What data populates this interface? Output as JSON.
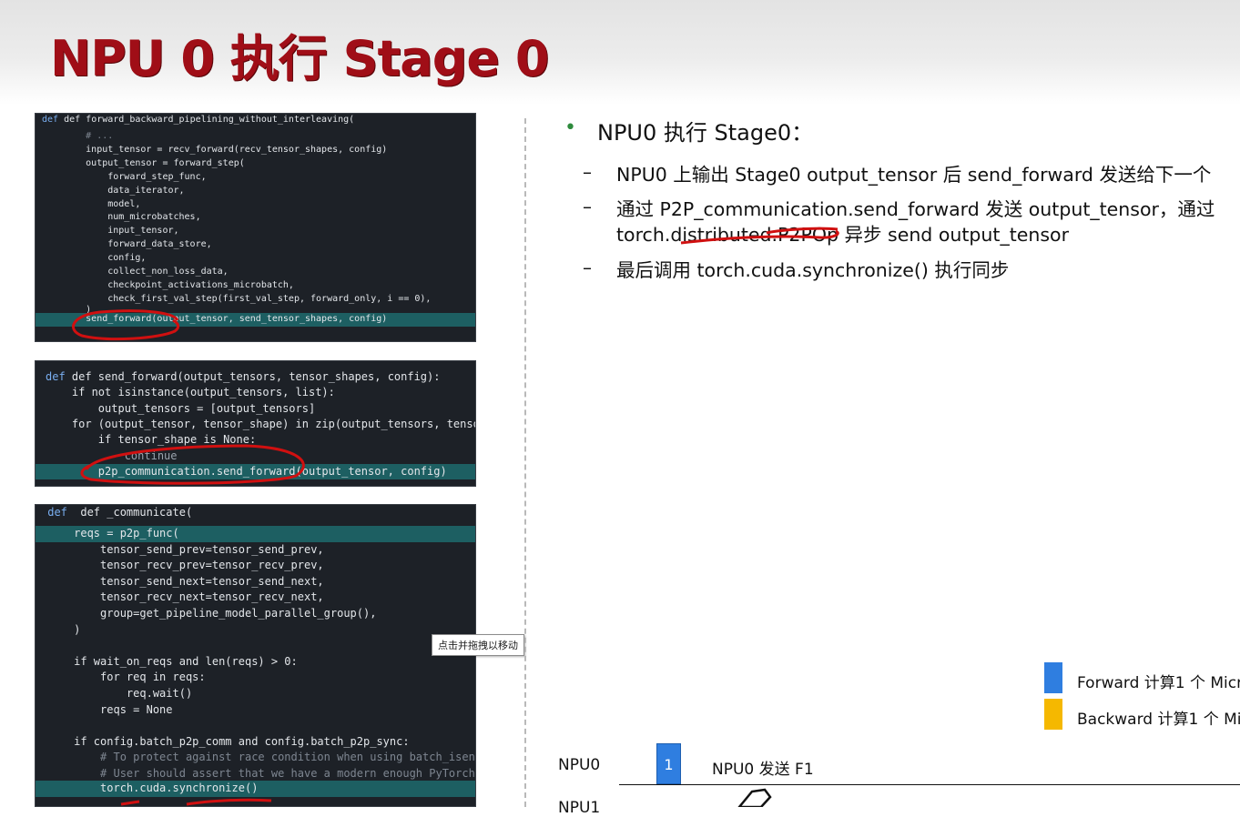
{
  "title": "NPU 0 执行 Stage 0",
  "code_blocks": [
    {
      "lines": [
        "def forward_backward_pipelining_without_interleaving(",
        "        # ...",
        "        input_tensor = recv_forward(recv_tensor_shapes, config)",
        "        output_tensor = forward_step(",
        "            forward_step_func,",
        "            data_iterator,",
        "            model,",
        "            num_microbatches,",
        "            input_tensor,",
        "            forward_data_store,",
        "            config,",
        "            collect_non_loss_data,",
        "            checkpoint_activations_microbatch,",
        "            check_first_val_step(first_val_step, forward_only, i == 0),",
        "        )",
        "        send_forward(output_tensor, send_tensor_shapes, config)"
      ]
    },
    {
      "lines": [
        "def send_forward(output_tensors, tensor_shapes, config):",
        "    if not isinstance(output_tensors, list):",
        "        output_tensors = [output_tensors]",
        "    for (output_tensor, tensor_shape) in zip(output_tensors, tensor_",
        "        if tensor_shape is None:",
        "            continue",
        "        p2p_communication.send_forward(output_tensor, config)"
      ]
    },
    {
      "lines": [
        " def _communicate(",
        "     reqs = p2p_func(",
        "         tensor_send_prev=tensor_send_prev,",
        "         tensor_recv_prev=tensor_recv_prev,",
        "         tensor_send_next=tensor_send_next,",
        "         tensor_recv_next=tensor_recv_next,",
        "         group=get_pipeline_model_parallel_group(),",
        "     )",
        "",
        "     if wait_on_reqs and len(reqs) > 0:",
        "         for req in reqs:",
        "             req.wait()",
        "         reqs = None",
        "",
        "     if config.batch_p2p_comm and config.batch_p2p_sync:",
        "         # To protect against race condition when using batch_isend_",
        "         # User should assert that we have a modern enough PyTorch t",
        "         torch.cuda.synchronize()"
      ]
    }
  ],
  "tooltip": "点击并拖拽以移动",
  "bullets": {
    "main": "NPU0 执行 Stage0：",
    "items": [
      "NPU0 上输出 Stage0 output_tensor 后 send_forward 发送给下一个",
      "通过 P2P_communication.send_forward 发送 output_tensor，通过",
      "torch.distributed.P2POp 异步 send output_tensor",
      "最后调用 torch.cuda.synchronize() 执行同步"
    ],
    "dash": "–"
  },
  "legend": [
    {
      "label": "Forward 计算1 个 Micr",
      "color": "#2f7ee0"
    },
    {
      "label": "Backward 计算1 个 Mi",
      "color": "#f5b800"
    }
  ],
  "timeline": {
    "npu0_label": "NPU0",
    "npu1_label": "NPU1",
    "block_label": "1",
    "send_label": "NPU0 发送 F1"
  },
  "colors": {
    "title": "#a00e17",
    "highlight": "#1d5f62",
    "annotation": "#d01010"
  }
}
